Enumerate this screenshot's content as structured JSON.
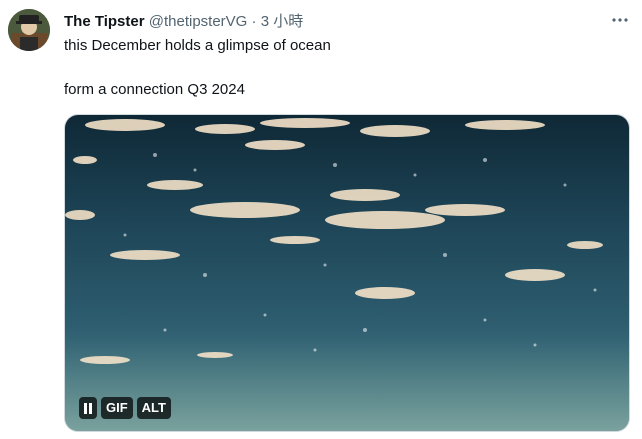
{
  "tweet": {
    "author_name": "The Tipster",
    "author_handle": "@thetipsterVG",
    "separator": "·",
    "timestamp": "3 小時",
    "more_icon": "more-horizontal-icon",
    "text_line1": "this December holds a glimpse of ocean",
    "text_line2": "form a connection Q3 2024"
  },
  "media": {
    "type": "gif",
    "pause_icon": "pause-icon",
    "gif_label": "GIF",
    "alt_label": "ALT"
  },
  "colors": {
    "text": "#0f1419",
    "muted": "#536471",
    "border": "#cfd9de",
    "water_dark": "#1b3d4f",
    "water_light": "#4d7f8c"
  }
}
